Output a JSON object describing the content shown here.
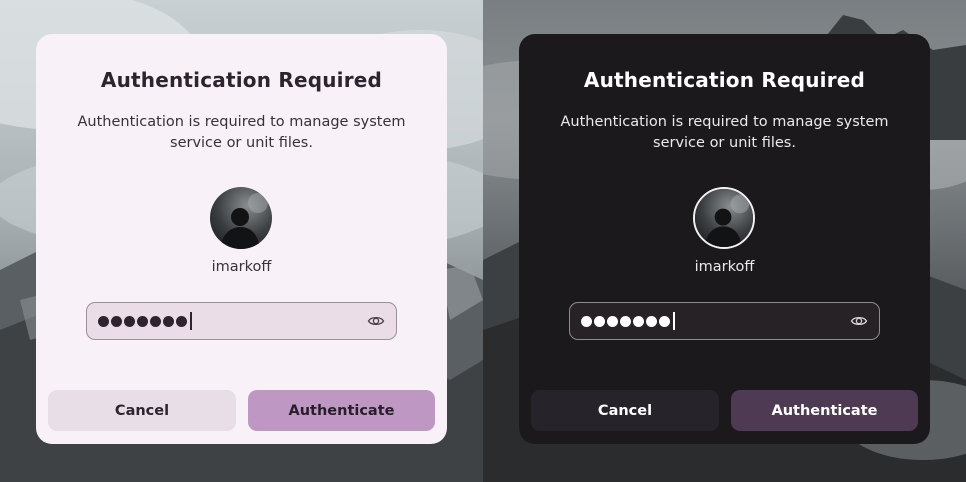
{
  "dialogs": [
    {
      "theme": "light",
      "title": "Authentication Required",
      "message": "Authentication is required to manage system service or unit files.",
      "username": "imarkoff",
      "password_length": 7,
      "cancel_label": "Cancel",
      "authenticate_label": "Authenticate",
      "colors": {
        "background": "#f8f2f8",
        "accent": "#be98c3",
        "field": "#eadde7"
      }
    },
    {
      "theme": "dark",
      "title": "Authentication Required",
      "message": "Authentication is required to manage system service or unit files.",
      "username": "imarkoff",
      "password_length": 7,
      "cancel_label": "Cancel",
      "authenticate_label": "Authenticate",
      "colors": {
        "background": "#1c191d",
        "accent": "#4e3a52",
        "field": "#262226"
      }
    }
  ],
  "icons": {
    "reveal_password": "eye-icon",
    "avatar": "user-avatar"
  }
}
